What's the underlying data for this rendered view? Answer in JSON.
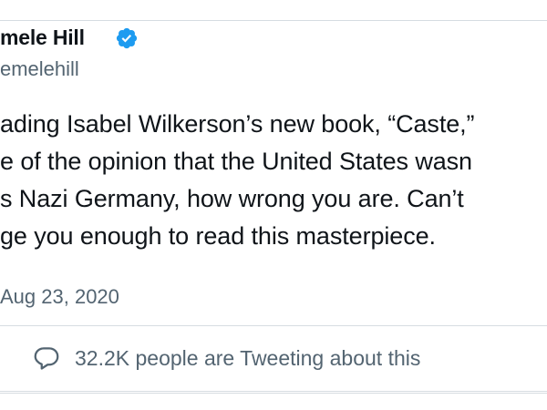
{
  "author": {
    "name": "mele Hill",
    "handle": "emelehill",
    "verified_icon": "verified-badge-icon",
    "verified_color": "#1d9bf0"
  },
  "tweet": {
    "lines": [
      "ading Isabel Wilkerson’s new book, “Caste,”",
      "e of the opinion that the United States wasn",
      "s Nazi Germany, how wrong you are. Can’t",
      "ge you enough to read this masterpiece."
    ],
    "date": "Aug 23, 2020"
  },
  "engagement": {
    "icon": "reply-bubble-icon",
    "text": "32.2K people are Tweeting about this"
  },
  "colors": {
    "text_primary": "#0f1419",
    "text_secondary": "#536471",
    "border": "#d6dce1"
  }
}
